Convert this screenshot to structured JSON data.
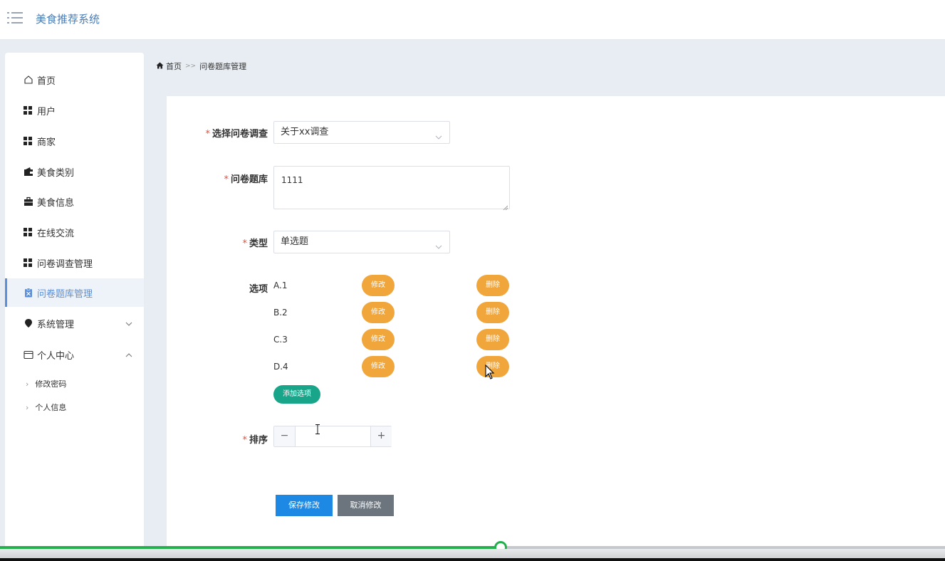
{
  "app": {
    "title": "美食推荐系统"
  },
  "sidebar": {
    "items": [
      {
        "label": "首页",
        "icon": "home-outline-icon"
      },
      {
        "label": "用户",
        "icon": "grid-icon"
      },
      {
        "label": "商家",
        "icon": "grid-icon"
      },
      {
        "label": "美食类别",
        "icon": "wallet-icon"
      },
      {
        "label": "美食信息",
        "icon": "briefcase-icon"
      },
      {
        "label": "在线交流",
        "icon": "grid-icon"
      },
      {
        "label": "问卷调查管理",
        "icon": "grid-icon"
      },
      {
        "label": "问卷题库管理",
        "icon": "clipboard-icon",
        "active": true
      },
      {
        "label": "系统管理",
        "icon": "pin-icon",
        "expandable": true,
        "expanded": false
      },
      {
        "label": "个人中心",
        "icon": "card-icon",
        "expandable": true,
        "expanded": true
      }
    ],
    "subitems": [
      {
        "label": "修改密码"
      },
      {
        "label": "个人信息"
      }
    ]
  },
  "breadcrumb": {
    "home": "首页",
    "separator": ">>",
    "current": "问卷题库管理"
  },
  "form": {
    "survey": {
      "label": "选择问卷调查",
      "value": "关于xx调查"
    },
    "question": {
      "label": "问卷题库",
      "value": "1111"
    },
    "type": {
      "label": "类型",
      "value": "单选题"
    },
    "options": {
      "label": "选项",
      "items": [
        {
          "text": "A.1"
        },
        {
          "text": "B.2"
        },
        {
          "text": "C.3"
        },
        {
          "text": "D.4"
        }
      ],
      "edit_label": "修改",
      "delete_label": "删除",
      "add_label": "添加选项"
    },
    "sort": {
      "label": "排序",
      "value": "",
      "minus": "−",
      "plus": "+"
    },
    "save_label": "保存修改",
    "cancel_label": "取消修改"
  },
  "colors": {
    "accent": "#5b8fd8",
    "required": "#e94b3c",
    "option_button": "#f0a63b",
    "add_button": "#18a58a",
    "save_button": "#1e88e5",
    "cancel_button": "#6c757d",
    "progress": "#23b14d"
  },
  "player": {
    "progress": 0.53
  }
}
